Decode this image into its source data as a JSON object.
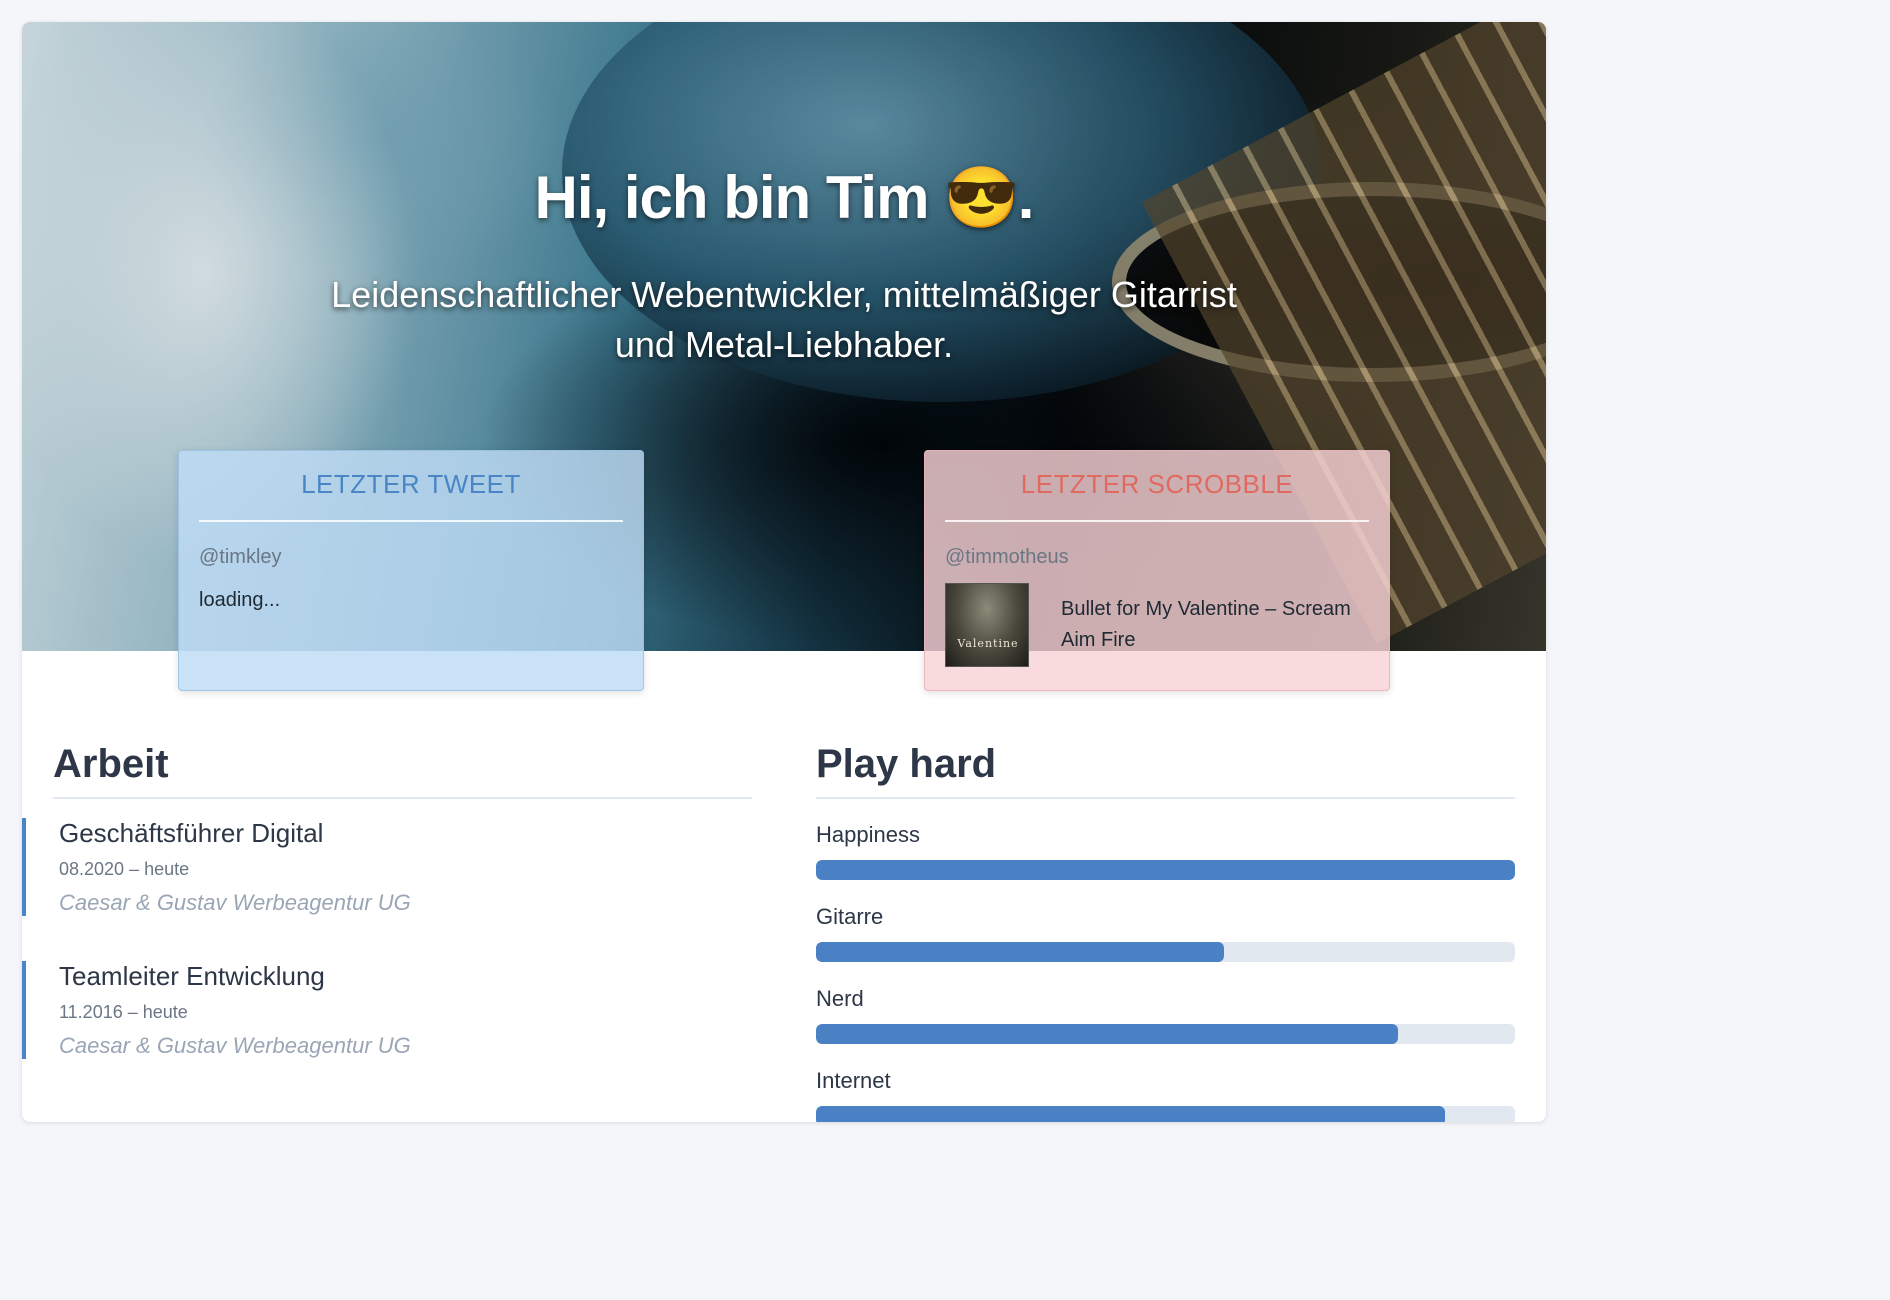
{
  "hero": {
    "title": "Hi, ich bin Tim 😎.",
    "subtitle": "Leidenschaftlicher Webentwickler, mittelmäßiger Gitarrist und Metal-Liebhaber."
  },
  "tweet_widget": {
    "title": "LETZTER TWEET",
    "handle": "@timkley",
    "body": "loading..."
  },
  "scrobble_widget": {
    "title": "LETZTER SCROBBLE",
    "handle": "@timmotheus",
    "track": "Bullet for My Valentine – Scream Aim Fire",
    "album_cover_text": "Valentine"
  },
  "work": {
    "heading": "Arbeit",
    "jobs": [
      {
        "title": "Geschäftsführer Digital",
        "date": "08.2020 – heute",
        "company": "Caesar & Gustav Werbeagentur UG"
      },
      {
        "title": "Teamleiter Entwicklung",
        "date": "11.2016 – heute",
        "company": "Caesar & Gustav Werbeagentur UG"
      }
    ]
  },
  "play": {
    "heading": "Play hard",
    "skills": [
      {
        "label": "Happiness",
        "level": 1.0
      },
      {
        "label": "Gitarre",
        "level": 0.584
      },
      {
        "label": "Nerd",
        "level": 0.833
      },
      {
        "label": "Internet",
        "level": 0.9
      }
    ]
  },
  "colors": {
    "accent_blue": "#4a80c4",
    "tweet_title": "#4a86c5",
    "scrobble_title": "#e06a60"
  }
}
